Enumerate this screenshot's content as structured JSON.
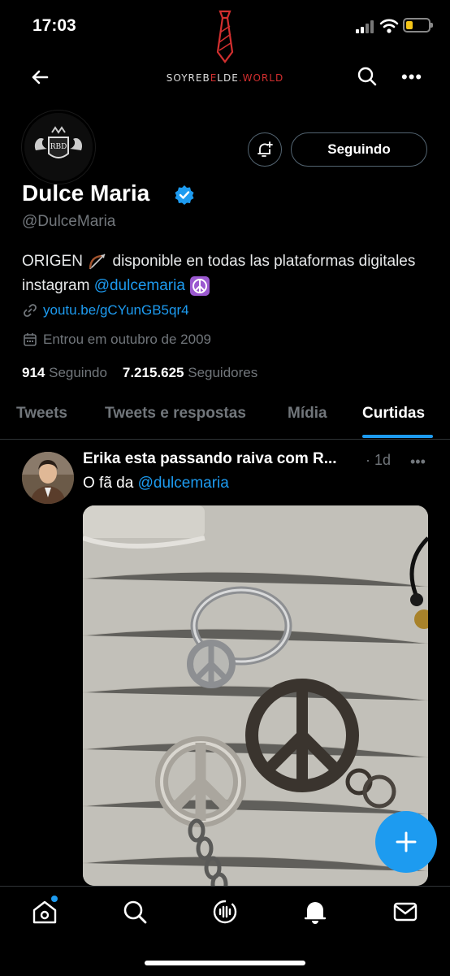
{
  "status_bar": {
    "time": "17:03"
  },
  "header": {
    "brand_prefix": "SOYREB",
    "brand_mid": "E",
    "brand_mid2": "LDE",
    "brand_suffix": ".WORLD"
  },
  "profile": {
    "name": "Dulce Maria",
    "handle": "@DulceMaria",
    "follow_button": "Seguindo",
    "bio_part1": "ORIGEN",
    "bio_part2": "disponible en todas las plataformas digitales instagram",
    "bio_mention": "@dulcemaria",
    "website": "youtu.be/gCYunGB5qr4",
    "joined": "Entrou em outubro de 2009",
    "following_count": "914",
    "following_label": "Seguindo",
    "followers_count": "7.215.625",
    "followers_label": "Seguidores"
  },
  "tabs": [
    {
      "label": "Tweets"
    },
    {
      "label": "Tweets e respostas"
    },
    {
      "label": "Mídia"
    },
    {
      "label": "Curtidas"
    }
  ],
  "tweet": {
    "author": "Erika esta passando raiva com R...",
    "separator": "·",
    "time": "1d",
    "text": "O fã da",
    "mention": "@dulcemaria"
  },
  "colors": {
    "accent": "#1d9bf0",
    "background": "#000000",
    "secondary_text": "#71767b",
    "brand_red": "#d32f2f"
  },
  "icons": {
    "back": "arrow-left-icon",
    "search": "search-icon",
    "more": "more-horizontal-icon",
    "notifications": "bell-plus-icon",
    "verified": "verified-badge-icon",
    "link": "link-icon",
    "calendar": "calendar-icon",
    "compose": "plus-icon",
    "nav": [
      "home-icon",
      "search-icon",
      "spaces-icon",
      "notifications-icon",
      "messages-icon"
    ]
  }
}
